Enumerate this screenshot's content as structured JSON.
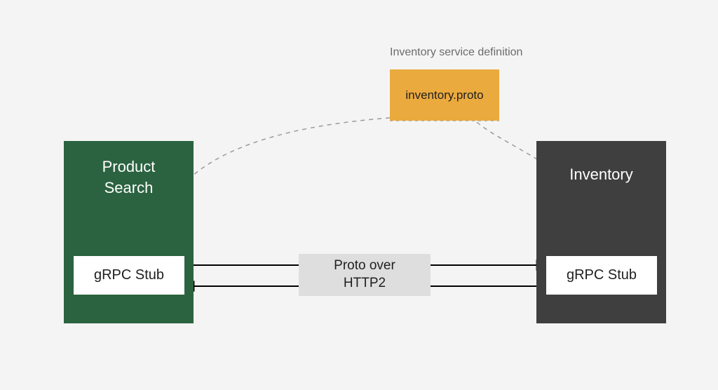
{
  "diagram": {
    "definition_label": "Inventory service definition",
    "proto_file": "inventory.proto",
    "left_service": "Product\nSearch",
    "right_service": "Inventory",
    "left_stub": "gRPC Stub",
    "right_stub": "gRPC Stub",
    "transport": "Proto over\nHTTP2"
  }
}
